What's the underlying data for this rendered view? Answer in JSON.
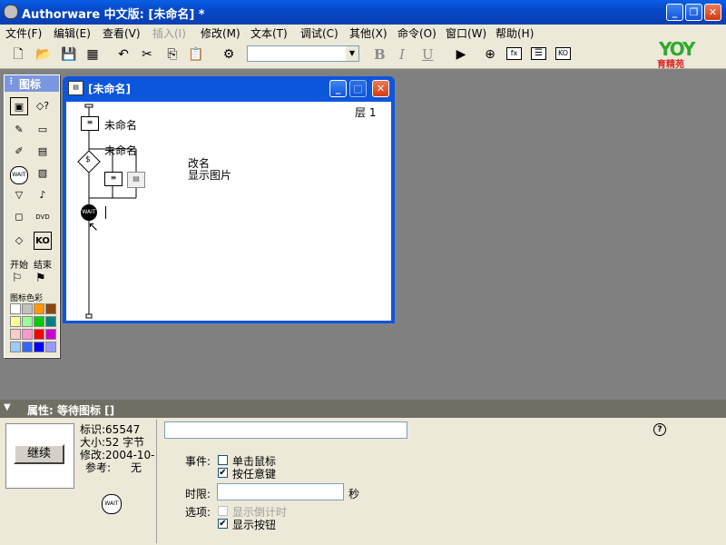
{
  "window": {
    "title": "Authorware 中文版: [未命名] *"
  },
  "menu": [
    {
      "label": "文件(F)",
      "enabled": true
    },
    {
      "label": "编辑(E)",
      "enabled": true
    },
    {
      "label": "查看(V)",
      "enabled": true
    },
    {
      "label": "插入(I)",
      "enabled": false
    },
    {
      "label": "修改(M)",
      "enabled": true
    },
    {
      "label": "文本(T)",
      "enabled": true
    },
    {
      "label": "调试(C)",
      "enabled": true
    },
    {
      "label": "其他(X)",
      "enabled": true
    },
    {
      "label": "命令(O)",
      "enabled": true
    },
    {
      "label": "窗口(W)",
      "enabled": true
    },
    {
      "label": "帮助(H)",
      "enabled": true
    }
  ],
  "toolbar": {
    "font_value": "",
    "bold": "B",
    "italic": "I",
    "underline": "U",
    "functions_label": "fx",
    "knowledge_label": "KO"
  },
  "logo": {
    "text": "YOY",
    "subtitle": "育精苑"
  },
  "palette": {
    "title": "图标",
    "start_label": "开始",
    "end_label": "结束",
    "color_label": "图标色彩",
    "knowledge_label": "KO",
    "dvd_label": "DVD",
    "wait_label": "WAIT",
    "colors": [
      "#ffffff",
      "#c0c0c0",
      "#ff9900",
      "#8b4513",
      "#ffff99",
      "#99ff99",
      "#00cc00",
      "#008080",
      "#ffcccc",
      "#ff99cc",
      "#ff0000",
      "#cc00cc",
      "#99ccff",
      "#3366ff",
      "#0000ff",
      "#9999ff"
    ]
  },
  "flowline": {
    "title": "[未命名]",
    "level": "层 1",
    "display_label": "未命名",
    "interaction_label": "未命名",
    "response_label_1": "改名",
    "response_label_2": "显示图片",
    "wait_label": "WAIT"
  },
  "properties": {
    "title": "属性: 等待图标 []",
    "preview_button": "继续",
    "id": "标识:65547",
    "size": "大小:52 字节",
    "modified": "修改:2004-10-",
    "ref_label": "参考:",
    "ref_value": "无",
    "wait_icon_label": "WAIT",
    "name_value": "",
    "help": "?",
    "events_label": "事件:",
    "mouse_click": "单击鼠标",
    "mouse_click_checked": false,
    "any_key": "按任意键",
    "any_key_checked": true,
    "time_label": "时限:",
    "time_value": "",
    "seconds": "秒",
    "options_label": "选项:",
    "show_countdown": "显示倒计时",
    "show_countdown_checked": false,
    "show_button": "显示按钮",
    "show_button_checked": true
  }
}
